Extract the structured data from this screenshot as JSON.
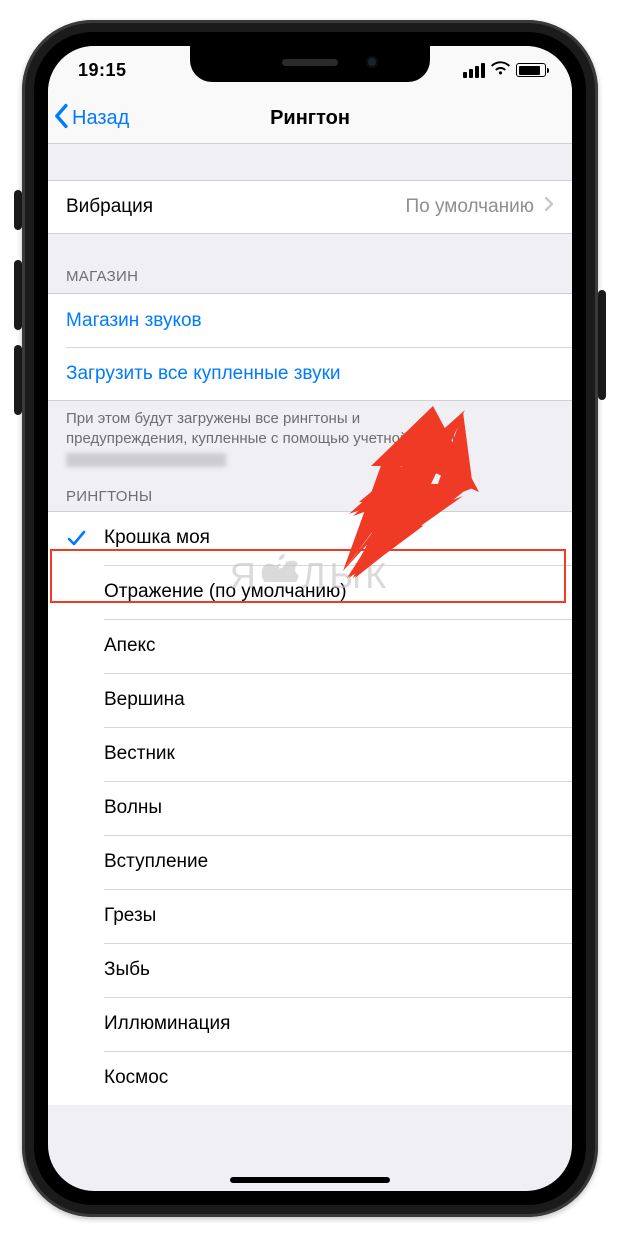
{
  "statusbar": {
    "time": "19:15"
  },
  "nav": {
    "back": "Назад",
    "title": "Рингтон"
  },
  "vibration": {
    "label": "Вибрация",
    "value": "По умолчанию"
  },
  "store": {
    "header": "МАГАЗИН",
    "sound_store": "Магазин звуков",
    "download_all": "Загрузить все купленные звуки",
    "footer_line1": "При этом будут загружены все рингтоны и",
    "footer_line2": "предупреждения, купленные с помощью учетной записи"
  },
  "ringtones": {
    "header": "РИНГТОНЫ",
    "selected_index": 0,
    "items": [
      "Крошка моя",
      "Отражение (по умолчанию)",
      "Апекс",
      "Вершина",
      "Вестник",
      "Волны",
      "Вступление",
      "Грезы",
      "Зыбь",
      "Иллюминация",
      "Космос"
    ]
  },
  "watermark": {
    "text_left": "Я",
    "text_right": "ЛЫК"
  },
  "colors": {
    "link": "#007aff",
    "accent_red": "#ef3a25"
  }
}
